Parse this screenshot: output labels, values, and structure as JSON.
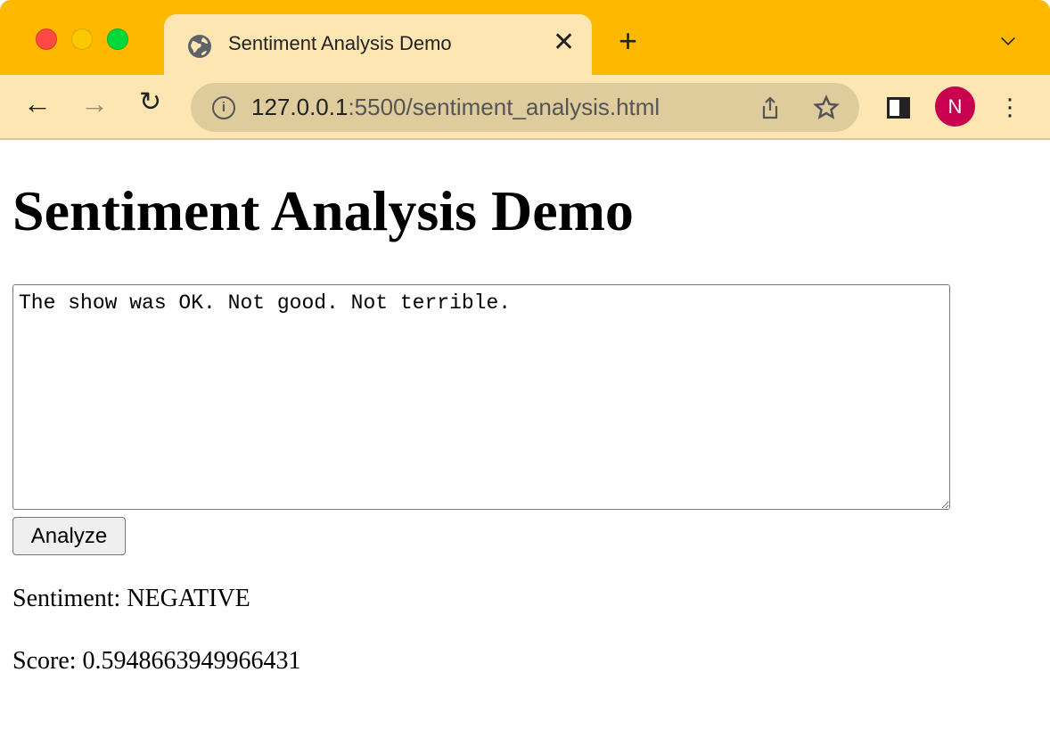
{
  "browser": {
    "tab_title": "Sentiment Analysis Demo",
    "url_host": "127.0.0.1",
    "url_rest": ":5500/sentiment_analysis.html",
    "avatar_initial": "N",
    "colors": {
      "tabstrip": "#ffb800",
      "toolbar": "#fde6b2",
      "avatar": "#c8004f"
    }
  },
  "page": {
    "heading": "Sentiment Analysis Demo",
    "textarea_value": "The show was OK. Not good. Not terrible.",
    "analyze_label": "Analyze",
    "sentiment_text": "Sentiment: NEGATIVE",
    "score_text": "Score: 0.5948663949966431"
  }
}
